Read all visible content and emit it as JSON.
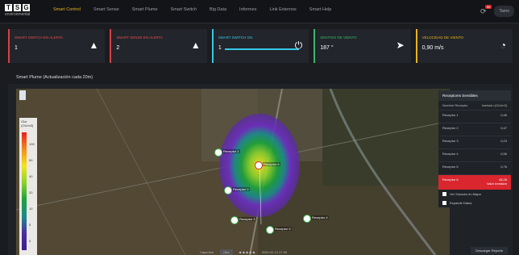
{
  "logo": {
    "letters": [
      "T",
      "S",
      "G"
    ],
    "sub": "environmental"
  },
  "nav": [
    "Smart Control",
    "Smart Sense",
    "Smart Plume",
    "Smart Switch",
    "Big Data",
    "Informes",
    "Link Externos",
    "Smart Help"
  ],
  "user": "Tarno",
  "notifications": "60",
  "cards": [
    {
      "title": "SMART SWITCH EN ALERTA",
      "value": "1",
      "icon": "warning-icon"
    },
    {
      "title": "SMART SENSE EN ALERTA",
      "value": "2",
      "icon": "warning-icon"
    },
    {
      "title": "SMART SWITCH ON",
      "value": "1",
      "icon": "switch-icon",
      "progress": 1.0
    },
    {
      "title": "SENTIDO DE VIENTO",
      "value": "187 °",
      "icon": "navigation-icon"
    },
    {
      "title": "VELOCIDAD DE VIENTO",
      "value": "0,90 m/s",
      "icon": "gauge-icon"
    }
  ],
  "section_title": "Smart Plume (Actualización cada 20m)",
  "legend": {
    "title": "Olor (OU/m3)",
    "ticks": [
      "100",
      "50",
      "40",
      "20",
      "10",
      "5",
      "0"
    ]
  },
  "receptors_panel": {
    "title": "Receptores Sensibles",
    "col1": "Nombre Receptor",
    "col2": "Inmisión (OU/m3)",
    "rows": [
      {
        "name": "Receptor 1",
        "value": "0,46"
      },
      {
        "name": "Receptor 2",
        "value": "0,47"
      },
      {
        "name": "Receptor 3",
        "value": "0,23"
      },
      {
        "name": "Receptor 4",
        "value": "0,56"
      },
      {
        "name": "Receptor 5",
        "value": "0,76"
      },
      {
        "name": "Receptor 6",
        "value": "45,26",
        "alert": true,
        "note": "Valor Inmisión"
      }
    ],
    "chk1": "Ver Sonares en Mapa",
    "chk2": "Expandir Datos"
  },
  "map_labels": [
    "Receptor 6",
    "Receptor 1",
    "Receptor 2",
    "Receptor 3",
    "Receptor 4",
    "Receptor 5"
  ],
  "footer": {
    "left": "Capa Avs",
    "btn": "Olor",
    "date": "2020-02-13 17:30"
  },
  "download": "Descargar Reporte"
}
